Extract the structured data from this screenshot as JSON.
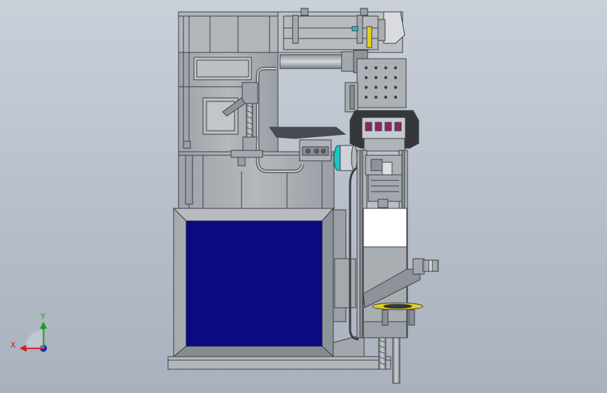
{
  "triad": {
    "x_label": "X",
    "y_label": "Y",
    "colors": {
      "x": "#d01818",
      "y": "#18a018",
      "z": "#1a2fd0"
    }
  },
  "colors": {
    "background_top": "#c9d0d9",
    "background_bottom": "#a8b1bd",
    "frame_gray": "#a9adb2",
    "line": "#3b3f44",
    "panel_blue": "#0a0a82",
    "white_panel": "#ffffff",
    "accent_cyan": "#19c6c6",
    "accent_yellow": "#e0d21c",
    "accent_magenta": "#8e2466"
  }
}
